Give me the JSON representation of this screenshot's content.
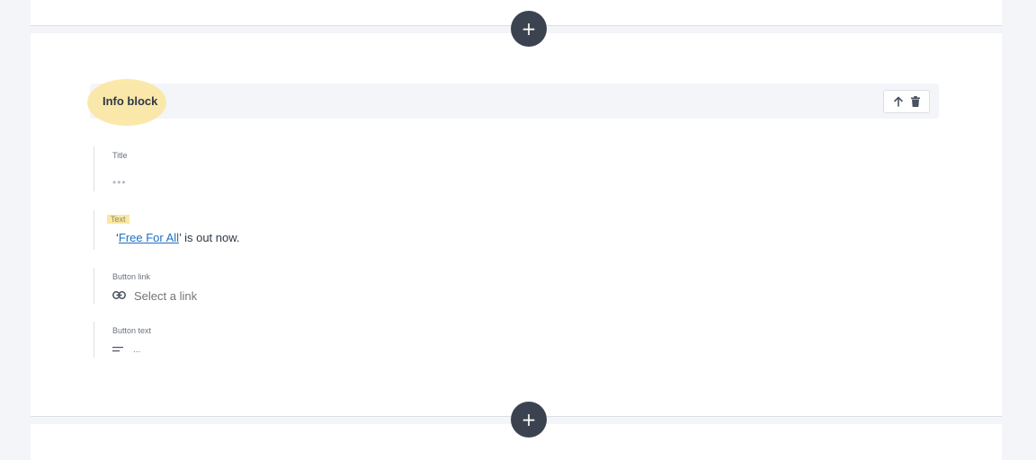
{
  "actions": {
    "add_above_label": "+",
    "add_below_label": "+"
  },
  "block": {
    "title": "Info block",
    "tools": {
      "move_up_icon": "arrow-up-icon",
      "delete_icon": "trash-icon"
    }
  },
  "fields": {
    "title": {
      "label": "Title",
      "value": "•••"
    },
    "text": {
      "label": "Text",
      "prefix": "‘",
      "link_text": "Free For All",
      "suffix": "’ is out now."
    },
    "button_link": {
      "label": "Button link",
      "icon": "link-icon",
      "placeholder": "Select a link"
    },
    "button_text": {
      "label": "Button text",
      "icon": "text-lines-icon",
      "placeholder": "..."
    }
  },
  "colors": {
    "highlight": "#fbe7a1",
    "add_button": "#3c4350",
    "link": "#1f6fc5"
  }
}
